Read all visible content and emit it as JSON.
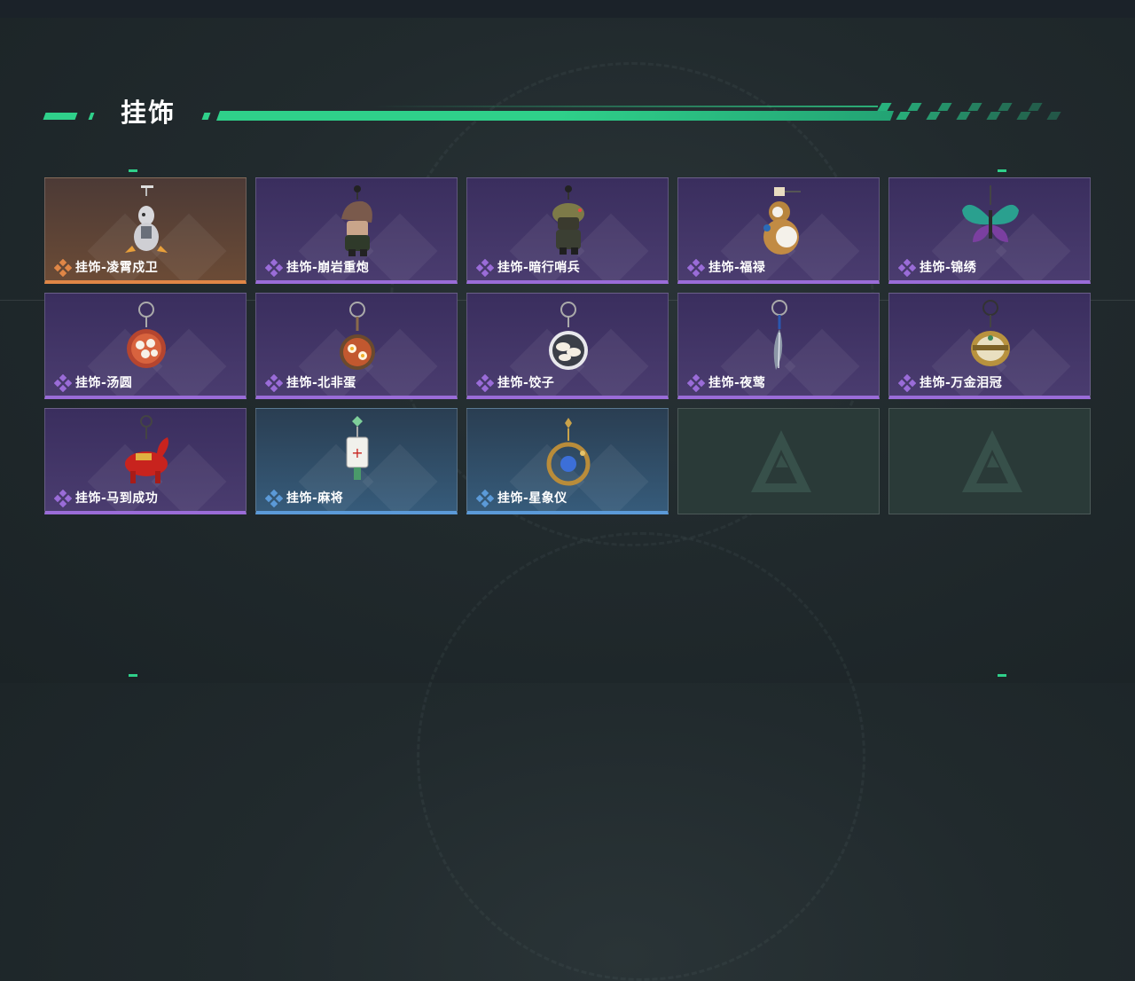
{
  "section": {
    "title": "挂饰"
  },
  "colors": {
    "accent": "#2fd08a",
    "rarity_purple": "#9a6cd8",
    "rarity_orange": "#e08646",
    "rarity_blue": "#5b9ad8"
  },
  "items": [
    {
      "name": "挂饰-凌霄戍卫",
      "rarity": "orange",
      "icon": "armored-bird-charm-icon"
    },
    {
      "name": "挂饰-崩岩重炮",
      "rarity": "purple",
      "icon": "rock-hat-soldier-charm-icon"
    },
    {
      "name": "挂饰-暗行哨兵",
      "rarity": "purple",
      "icon": "camo-sentry-charm-icon"
    },
    {
      "name": "挂饰-福禄",
      "rarity": "purple",
      "icon": "gourd-charm-icon"
    },
    {
      "name": "挂饰-锦绣",
      "rarity": "purple",
      "icon": "butterfly-charm-icon"
    },
    {
      "name": "挂饰-汤圆",
      "rarity": "purple",
      "icon": "rice-ball-bowl-charm-icon"
    },
    {
      "name": "挂饰-北非蛋",
      "rarity": "purple",
      "icon": "shakshuka-pan-charm-icon"
    },
    {
      "name": "挂饰-饺子",
      "rarity": "purple",
      "icon": "dumpling-plate-charm-icon"
    },
    {
      "name": "挂饰-夜莺",
      "rarity": "purple",
      "icon": "feather-charm-icon"
    },
    {
      "name": "挂饰-万金泪冠",
      "rarity": "purple",
      "icon": "golden-crown-charm-icon"
    },
    {
      "name": "挂饰-马到成功",
      "rarity": "purple",
      "icon": "red-horse-charm-icon"
    },
    {
      "name": "挂饰-麻将",
      "rarity": "blue",
      "icon": "mahjong-tile-charm-icon"
    },
    {
      "name": "挂饰-星象仪",
      "rarity": "blue",
      "icon": "astrolabe-charm-icon"
    }
  ],
  "empty_slots": [
    {
      "icon": "game-logo-icon"
    },
    {
      "icon": "game-logo-icon"
    }
  ]
}
